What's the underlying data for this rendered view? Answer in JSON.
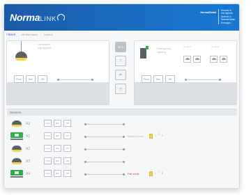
{
  "app": {
    "logo_main": "Norma",
    "logo_sub": "LINK",
    "brand_name": "NormaGlobal",
    "brand_tagline": "Normal at\nthe highest\nNormal in\nNormaGlobal\nEmergen..."
  },
  "nav": {
    "back_label": "Back",
    "crumbs": [
      "All test users",
      "Level 1"
    ]
  },
  "left_panel": {
    "label": "Luminaire\nhighlighted",
    "buttons": [
      "Fnce",
      "Dim",
      "Off"
    ]
  },
  "controls": {
    "items": [
      {
        "icon": "info",
        "label": "INFO"
      },
      {
        "icon": "t-icon",
        "label": "T"
      },
      {
        "icon": "link-icon",
        "label": "⇄"
      },
      {
        "icon": "clock-icon",
        "label": "◷"
      }
    ]
  },
  "right_panel": {
    "label": "Emergency\nlighting",
    "mini_labels": [
      "Group 1",
      "Group 2"
    ],
    "buttons": [
      "Fnce",
      "Dim",
      "Off"
    ]
  },
  "devices": {
    "title": "Devices",
    "rows": [
      {
        "type": "lamp",
        "name": "A2",
        "buttons": [
          "Fnce",
          "Dim",
          "Off"
        ],
        "status": "",
        "icons": false,
        "fail": false
      },
      {
        "type": "exit",
        "name": "A1",
        "buttons": [
          "Fnce",
          "Dim",
          "Off"
        ],
        "status": "Normal mode",
        "icons": true,
        "fail": false
      },
      {
        "type": "lamp",
        "name": "A2",
        "buttons": [
          "Fnce",
          "Dim",
          "Off"
        ],
        "status": "",
        "icons": false,
        "fail": false
      },
      {
        "type": "lamp",
        "name": "A3",
        "buttons": [
          "Fnce",
          "Dim",
          "Off"
        ],
        "status": "",
        "icons": false,
        "fail": false
      },
      {
        "type": "exit",
        "name": "A4",
        "buttons": [
          "Fnce",
          "Dim",
          "Off"
        ],
        "status": "Fail mode",
        "icons": true,
        "fail": true
      }
    ]
  },
  "colors": {
    "header": "#1a6cc2",
    "accent_yellow": "#f3d24a",
    "exit_green": "#2fae4b",
    "fail_red": "#e0322b"
  }
}
